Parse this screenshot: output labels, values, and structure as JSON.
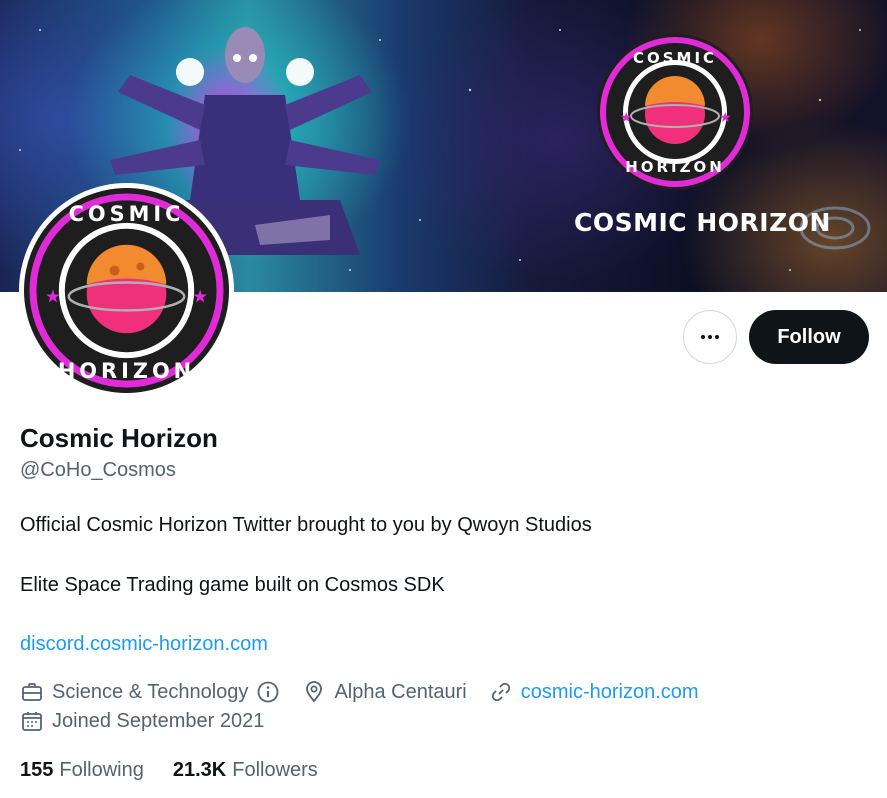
{
  "banner": {
    "title": "COSMIC HORIZON",
    "logo_top_text": "COSMIC",
    "logo_bottom_text": "HORIZON"
  },
  "avatar": {
    "logo_top_text": "COSMIC",
    "logo_bottom_text": "HORIZON"
  },
  "actions": {
    "more_icon": "ellipsis-icon",
    "follow_label": "Follow"
  },
  "profile": {
    "name": "Cosmic Horizon",
    "handle": "@CoHo_Cosmos",
    "bio_line1": "Official Cosmic Horizon Twitter brought to you by Qwoyn Studios",
    "bio_line2": "Elite Space Trading game built on Cosmos SDK",
    "bio_link": "discord.cosmic-horizon.com"
  },
  "meta": {
    "category": "Science & Technology",
    "location": "Alpha Centauri",
    "website": "cosmic-horizon.com",
    "joined": "Joined September 2021"
  },
  "stats": {
    "following_count": "155",
    "following_label": "Following",
    "followers_count": "21.3K",
    "followers_label": "Followers"
  },
  "colors": {
    "accent": "#1d9bf0",
    "text_primary": "#0f1419",
    "text_secondary": "#536471",
    "logo_ring": "#e12bd8"
  }
}
